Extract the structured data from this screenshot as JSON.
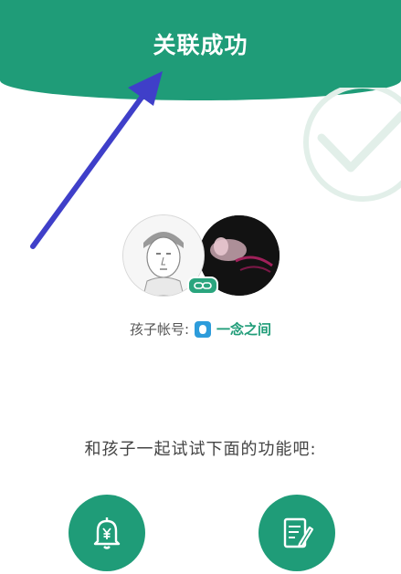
{
  "header": {
    "title": "关联成功"
  },
  "account": {
    "label": "孩子帐号:",
    "name": "一念之间"
  },
  "prompt": "和孩子一起试试下面的功能吧:",
  "features": [
    {
      "icon": "bell-yen-icon"
    },
    {
      "icon": "notes-pen-icon"
    }
  ],
  "colors": {
    "primary": "#1f9c78",
    "arrow": "#3f3fc9",
    "app_icon": "#2d9cdb"
  }
}
